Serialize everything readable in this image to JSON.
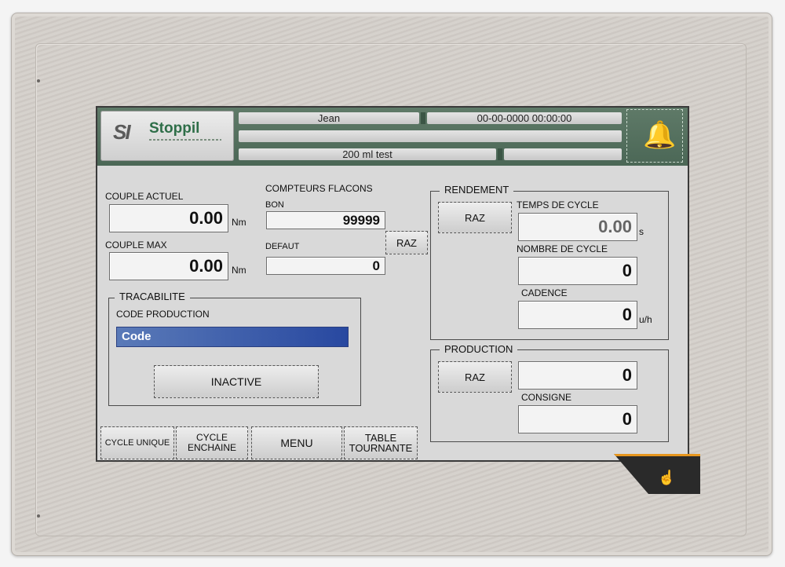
{
  "header": {
    "brand": "Stoppil",
    "brand_mark": "SI",
    "user": "Jean",
    "datetime": "00-00-0000 00:00:00",
    "recipe": "200 ml test",
    "alarm_icon": "bell-icon"
  },
  "torque": {
    "current_label": "COUPLE ACTUEL",
    "current_value": "0.00",
    "current_unit": "Nm",
    "max_label": "COUPLE MAX",
    "max_value": "0.00",
    "max_unit": "Nm"
  },
  "counters": {
    "title": "COMPTEURS FLACONS",
    "good_label": "BON",
    "good_value": "99999",
    "defect_label": "DEFAUT",
    "defect_value": "0",
    "reset_label": "RAZ"
  },
  "traceability": {
    "title": "TRACABILITE",
    "code_label": "CODE PRODUCTION",
    "code_value": "Code",
    "status_button": "INACTIVE"
  },
  "yield": {
    "title": "RENDEMENT",
    "reset_label": "RAZ",
    "cycle_time_label": "TEMPS DE CYCLE",
    "cycle_time_value": "0.00",
    "cycle_time_unit": "s",
    "cycle_count_label": "NOMBRE DE CYCLE",
    "cycle_count_value": "0",
    "rate_label": "CADENCE",
    "rate_value": "0",
    "rate_unit": "u/h"
  },
  "production": {
    "title": "PRODUCTION",
    "reset_label": "RAZ",
    "count_value": "0",
    "setpoint_label": "CONSIGNE",
    "setpoint_value": "0"
  },
  "bottom_buttons": {
    "single_cycle": "CYCLE UNIQUE",
    "chain_cycle_1": "CYCLE",
    "chain_cycle_2": "ENCHAINE",
    "menu": "MENU",
    "table_1": "TABLE",
    "table_2": "TOURNANTE"
  },
  "device": {
    "touch_icon": "touch-hand-icon"
  }
}
